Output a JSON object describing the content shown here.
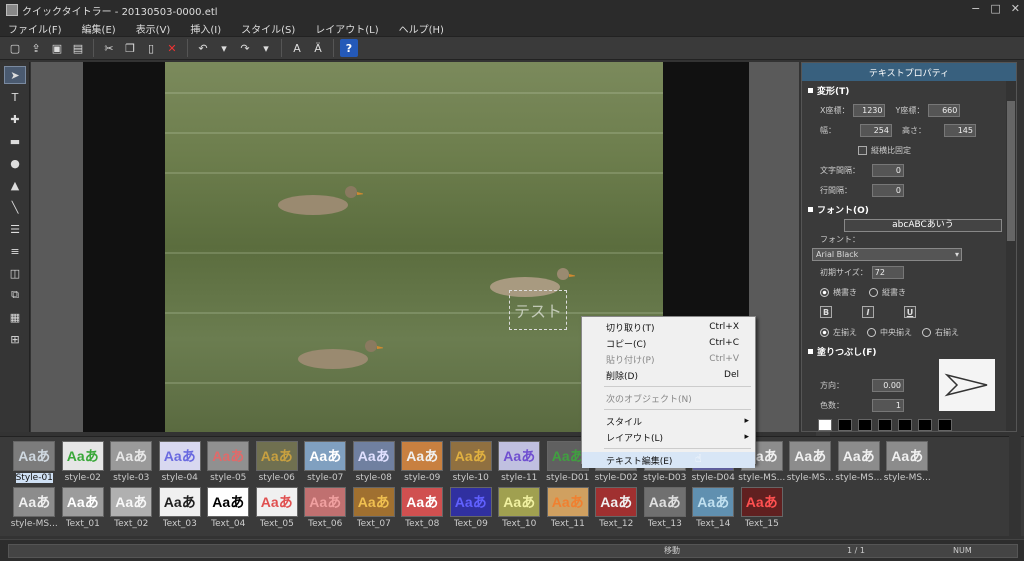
{
  "window": {
    "title": "クイックタイトラー - 20130503-0000.etl",
    "controls": [
      "−",
      "□",
      "✕"
    ]
  },
  "menubar": [
    "ファイル(F)",
    "編集(E)",
    "表示(V)",
    "挿入(I)",
    "スタイル(S)",
    "レイアウト(L)",
    "ヘルプ(H)"
  ],
  "toolbar_icons": [
    "new-icon",
    "open-icon",
    "save-icon",
    "save-as-icon",
    "cut-icon",
    "copy-icon",
    "paste-icon",
    "delete-icon",
    "undo-icon",
    "redo-icon",
    "text-effect-icon",
    "font-icon",
    "help-icon"
  ],
  "left_tools": [
    "select-arrow-icon",
    "text-tool-icon",
    "crop-icon",
    "rectangle-icon",
    "ellipse-icon",
    "triangle-icon",
    "line-icon",
    "align-icon",
    "distribute-icon",
    "layer-icon",
    "group-icon",
    "grid-icon",
    "table-icon"
  ],
  "canvas": {
    "selected_text": "テスト"
  },
  "properties": {
    "header": "テキストプロパティ",
    "transform": {
      "title": "変形(T)",
      "x_label": "X座標：",
      "x_value": "1230",
      "y_label": "Y座標：",
      "y_value": "660",
      "w_label": "幅：",
      "w_value": "254",
      "h_label": "高さ：",
      "h_value": "145",
      "aspect_label": "縦横比固定",
      "char_spacing_label": "文字間隔：",
      "char_spacing_value": "0",
      "line_spacing_label": "行間隔：",
      "line_spacing_value": "0"
    },
    "font": {
      "title": "フォント(O)",
      "sample": "abcABCあいう",
      "font_label": "フォント：",
      "font_value": "Arial Black",
      "size_label": "初期サイズ：",
      "size_value": "72",
      "horizontal": "横書き",
      "vertical": "縦書き",
      "bold": "B",
      "italic": "I",
      "underline": "U",
      "align_left": "左揃え",
      "align_center": "中央揃え",
      "align_right": "右揃え"
    },
    "fill": {
      "title": "塗りつぶし(F)",
      "direction_label": "方向：",
      "direction_value": "0.00",
      "count_label": "色数：",
      "count_value": "1"
    }
  },
  "context_menu": {
    "items": [
      {
        "label": "切り取り(T)",
        "shortcut": "Ctrl+X",
        "disabled": false
      },
      {
        "label": "コピー(C)",
        "shortcut": "Ctrl+C",
        "disabled": false
      },
      {
        "label": "貼り付け(P)",
        "shortcut": "Ctrl+V",
        "disabled": true
      },
      {
        "label": "削除(D)",
        "shortcut": "Del",
        "disabled": false
      },
      {
        "label": "次のオブジェクト(N)",
        "shortcut": "",
        "disabled": true
      },
      {
        "label": "スタイル",
        "shortcut": "",
        "disabled": false,
        "submenu": true
      },
      {
        "label": "レイアウト(L)",
        "shortcut": "",
        "disabled": false,
        "submenu": true
      },
      {
        "label": "テキスト編集(E)",
        "shortcut": "",
        "disabled": false
      }
    ]
  },
  "styles": {
    "thumb_text": "Aaあ",
    "row1": [
      {
        "name": "Style-01",
        "fg": "#cfd8e0",
        "bg": "#7c7c7c"
      },
      {
        "name": "style-02",
        "fg": "#3aa83a",
        "bg": "#e6e6e6"
      },
      {
        "name": "style-03",
        "fg": "#e8e8e8",
        "bg": "#9a9a9a"
      },
      {
        "name": "style-04",
        "fg": "#6a6ae0",
        "bg": "#d8d8f0"
      },
      {
        "name": "style-05",
        "fg": "#e06a6a",
        "bg": "#909090"
      },
      {
        "name": "style-06",
        "fg": "#c8a040",
        "bg": "#707050"
      },
      {
        "name": "style-07",
        "fg": "#ffffff",
        "bg": "#80a0c0"
      },
      {
        "name": "style-08",
        "fg": "#e0e0ff",
        "bg": "#7080a0"
      },
      {
        "name": "style-09",
        "fg": "#f0f0f0",
        "bg": "#c88040"
      },
      {
        "name": "style-10",
        "fg": "#e0b040",
        "bg": "#907040"
      },
      {
        "name": "style-11",
        "fg": "#7050d0",
        "bg": "#c0c0e0"
      },
      {
        "name": "style-D01",
        "fg": "#40a040",
        "bg": "#606060"
      },
      {
        "name": "style-D02",
        "fg": "#f0f0f0",
        "bg": "#808080"
      },
      {
        "name": "style-D03",
        "fg": "#e0e0e0",
        "bg": "#909090"
      },
      {
        "name": "style-D04",
        "fg": "#ffffff",
        "bg": "#6060a0"
      },
      {
        "name": "style-MS...",
        "fg": "#f0f0f0",
        "bg": "#8c8c8c"
      },
      {
        "name": "style-MS...",
        "fg": "#f0f0f0",
        "bg": "#8c8c8c"
      },
      {
        "name": "style-MS...",
        "fg": "#f0f0f0",
        "bg": "#8c8c8c"
      },
      {
        "name": "style-MS...",
        "fg": "#f0f0f0",
        "bg": "#8c8c8c"
      }
    ],
    "row2": [
      {
        "name": "style-MS...",
        "fg": "#f0f0f0",
        "bg": "#8c8c8c"
      },
      {
        "name": "Text_01",
        "fg": "#ffffff",
        "bg": "#9c9c9c"
      },
      {
        "name": "Text_02",
        "fg": "#f8f8f8",
        "bg": "#b0b0b0"
      },
      {
        "name": "Text_03",
        "fg": "#202020",
        "bg": "#f0f0f0"
      },
      {
        "name": "Text_04",
        "fg": "#000000",
        "bg": "#ffffff"
      },
      {
        "name": "Text_05",
        "fg": "#e05050",
        "bg": "#f0f0f0"
      },
      {
        "name": "Text_06",
        "fg": "#f0a0a0",
        "bg": "#c07070"
      },
      {
        "name": "Text_07",
        "fg": "#f0c050",
        "bg": "#a07030"
      },
      {
        "name": "Text_08",
        "fg": "#ffffff",
        "bg": "#d05050"
      },
      {
        "name": "Text_09",
        "fg": "#6060ff",
        "bg": "#3030a0"
      },
      {
        "name": "Text_10",
        "fg": "#f0f0a0",
        "bg": "#a0a050"
      },
      {
        "name": "Text_11",
        "fg": "#f08030",
        "bg": "#d0a060"
      },
      {
        "name": "Text_12",
        "fg": "#f0f0f0",
        "bg": "#a03030"
      },
      {
        "name": "Text_13",
        "fg": "#e0e0e0",
        "bg": "#707070"
      },
      {
        "name": "Text_14",
        "fg": "#c0e0f0",
        "bg": "#6090b0"
      },
      {
        "name": "Text_15",
        "fg": "#ff5050",
        "bg": "#602020"
      }
    ]
  },
  "statusbar": {
    "mode": "移動",
    "page": "1 / 1",
    "numlock": "NUM"
  }
}
